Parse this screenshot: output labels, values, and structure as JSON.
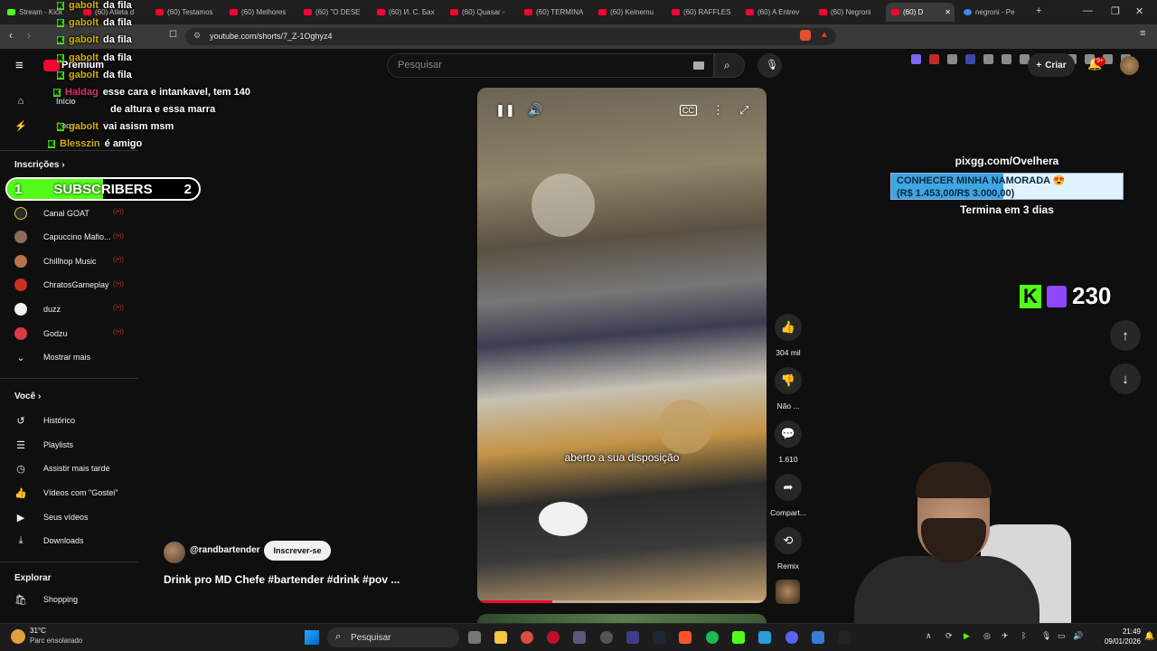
{
  "browser": {
    "tabs": [
      {
        "label": "Stream - Kick"
      },
      {
        "label": "(60) Atleta d"
      },
      {
        "label": "(60) Testamos"
      },
      {
        "label": "(60) Melhores"
      },
      {
        "label": "(60) \"O DESE"
      },
      {
        "label": "(60) И. С. Бах"
      },
      {
        "label": "(60) Quasar -"
      },
      {
        "label": "(60) TERMINA"
      },
      {
        "label": "(60) Keinemu"
      },
      {
        "label": "(60) RAFFLES"
      },
      {
        "label": "(60) A Entrev"
      },
      {
        "label": "(60) Negroni"
      },
      {
        "label": "(60) D"
      },
      {
        "label": "negroni - Pe"
      }
    ],
    "url": "youtube.com/shorts/7_Z-1Oghyz4"
  },
  "youtube": {
    "logo_badge": "Premium",
    "search_placeholder": "Pesquisar",
    "create_label": "Criar",
    "notif_count": "9+",
    "sidebar": {
      "top": [
        {
          "label": "Início"
        },
        {
          "label": "Shorts"
        }
      ],
      "subs_title": "Inscrições",
      "channels": [
        {
          "label": "Canal GOAT",
          "color": "#2b2b2b"
        },
        {
          "label": "Capuccino Mafio...",
          "color": "#8a6d5a"
        },
        {
          "label": "Chillhop Music",
          "color": "#b5754a"
        },
        {
          "label": "ChratosGameplay",
          "color": "#c8321e"
        },
        {
          "label": "duzz",
          "color": "#f1f1f1"
        },
        {
          "label": "Godzu",
          "color": "#d93844"
        }
      ],
      "more_label": "Mostrar mais",
      "you_title": "Você",
      "you_items": [
        {
          "label": "Histórico"
        },
        {
          "label": "Playlists"
        },
        {
          "label": "Assistir mais tarde"
        },
        {
          "label": "Vídeos com \"Gostei\""
        },
        {
          "label": "Seus vídeos"
        },
        {
          "label": "Downloads"
        }
      ],
      "explore_title": "Explorar",
      "explore_items": [
        {
          "label": "Shopping"
        }
      ]
    },
    "video": {
      "caption": "aberto a sua disposição",
      "progress_pct": 26,
      "channel": "@randbartender",
      "subscribe_label": "Inscrever-se",
      "title": "Drink pro MD Chefe #bartender #drink #pov ..."
    },
    "actions": {
      "likes": "304 mil",
      "dislike": "Não ...",
      "comments": "1.610",
      "share": "Compart...",
      "remix": "Remix"
    }
  },
  "overlay": {
    "chat": [
      {
        "name": "gabolt",
        "msg": "da fila",
        "color": "#d4b100"
      },
      {
        "name": "gabolt",
        "msg": "da fila",
        "color": "#d4b100"
      },
      {
        "name": "gabolt",
        "msg": "da fila",
        "color": "#d4b100"
      },
      {
        "name": "gabolt",
        "msg": "da fila",
        "color": "#d4b100"
      },
      {
        "name": "gabolt",
        "msg": "da fila",
        "color": "#d4b100"
      },
      {
        "name": "Haldag",
        "msg": "esse cara e intankavel, tem 140",
        "color": "#e0306a"
      },
      {
        "name": "",
        "msg": "de altura e essa marra",
        "color": "#e0306a"
      },
      {
        "name": "gabolt",
        "msg": "vai asism msm",
        "color": "#d4b100"
      },
      {
        "name": "Blesszin",
        "msg": "é amigo",
        "color": "#d4b100"
      }
    ],
    "subs_goal": {
      "current": "1",
      "label": "SUBSCRIBERS",
      "target": "2",
      "fill_fraction": 0.5
    },
    "pix": {
      "url": "pixgg.com/Ovelhera",
      "goal_line1": "CONHECER MINHA NAMORADA 😍",
      "goal_line2": "(R$ 1.453,00/R$ 3.000,00)",
      "fill_fraction": 0.484,
      "ends": "Termina em 3 dias"
    },
    "viewers": "230"
  },
  "taskbar": {
    "weather_temp": "31°C",
    "weather_desc": "Parc ensolarado",
    "search_label": "Pesquisar",
    "time": "21:49",
    "date": "09/01/2026"
  },
  "colors": {
    "accent": "#ff0033",
    "kick": "#53fc18",
    "twitch": "#9146ff"
  }
}
